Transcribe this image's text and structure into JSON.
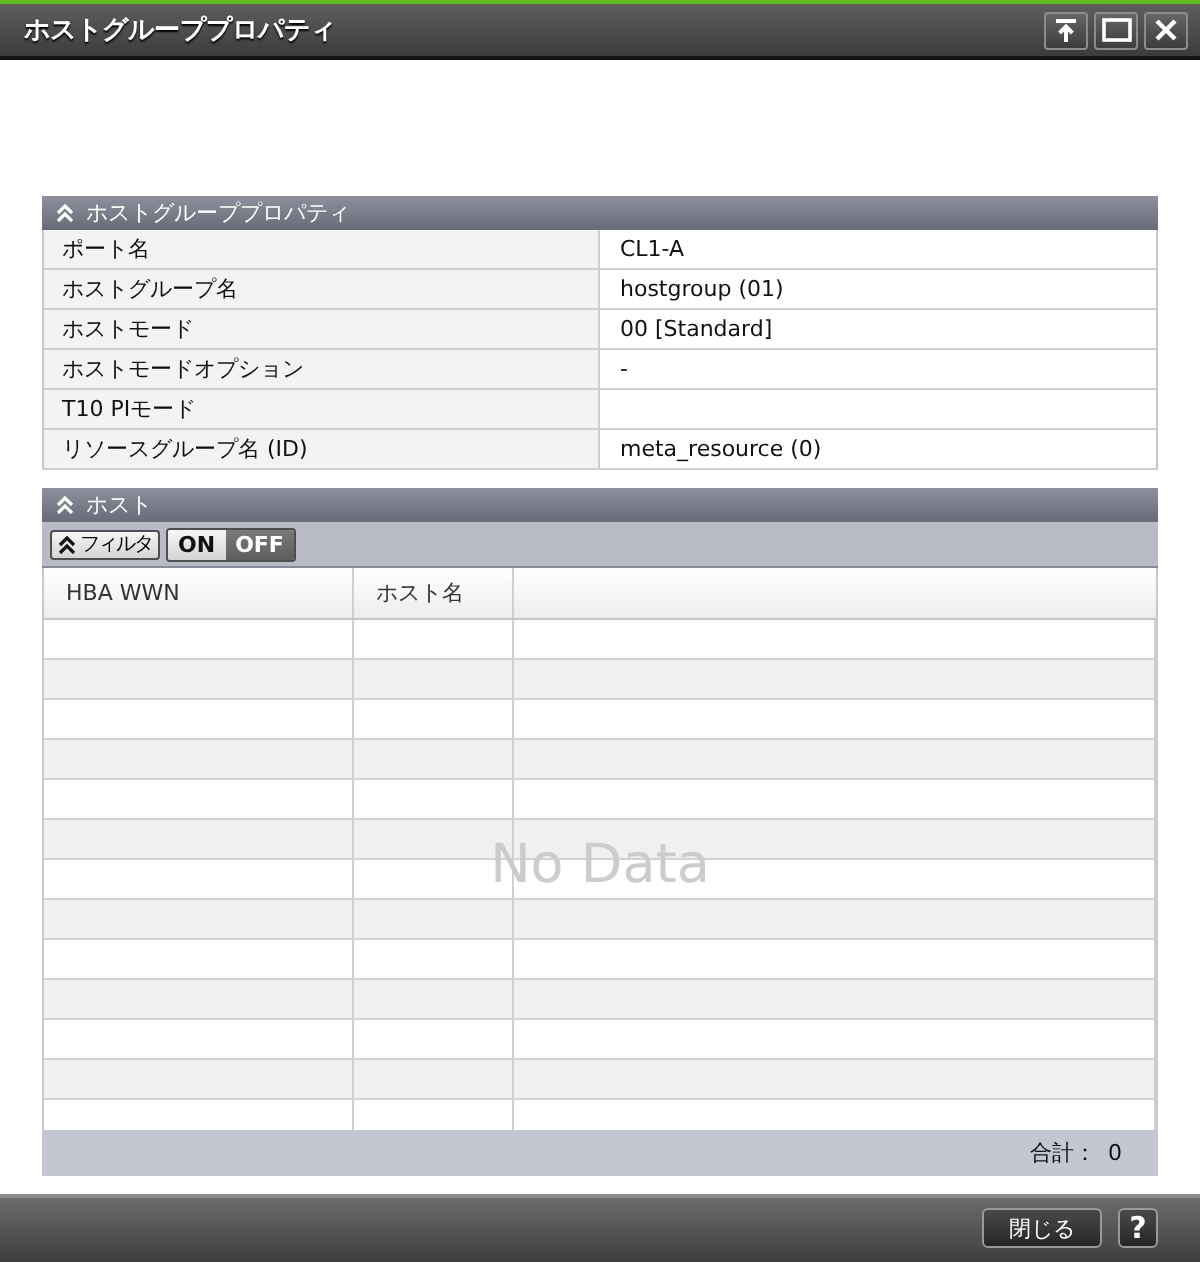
{
  "window": {
    "title": "ホストグループプロパティ"
  },
  "properties": {
    "title": "ホストグループプロパティ",
    "expanded": true,
    "rows": [
      {
        "label": "ポート名",
        "value": "CL1-A"
      },
      {
        "label": "ホストグループ名",
        "value": "hostgroup (01)"
      },
      {
        "label": "ホストモード",
        "value": "00 [Standard]"
      },
      {
        "label": "ホストモードオプション",
        "value": "-"
      },
      {
        "label": "T10 PIモード"
      },
      {
        "label": "リソースグループ名 (ID)",
        "value": "meta_resource (0)"
      }
    ]
  },
  "hosts": {
    "title": "ホスト",
    "expanded": true,
    "filter": {
      "label": "フィルタ",
      "options": [
        {
          "label": "ON",
          "selected": false
        },
        {
          "label": "OFF",
          "selected": true
        }
      ]
    },
    "table": {
      "columns": [
        "HBA WWN",
        "ホスト名"
      ],
      "empty_message": "No Data",
      "total_label": "合計：",
      "total": "0"
    }
  },
  "footer": {
    "buttons": [
      {
        "label": "閉じる",
        "kind": "text"
      },
      {
        "label": "?",
        "kind": "help"
      }
    ]
  }
}
